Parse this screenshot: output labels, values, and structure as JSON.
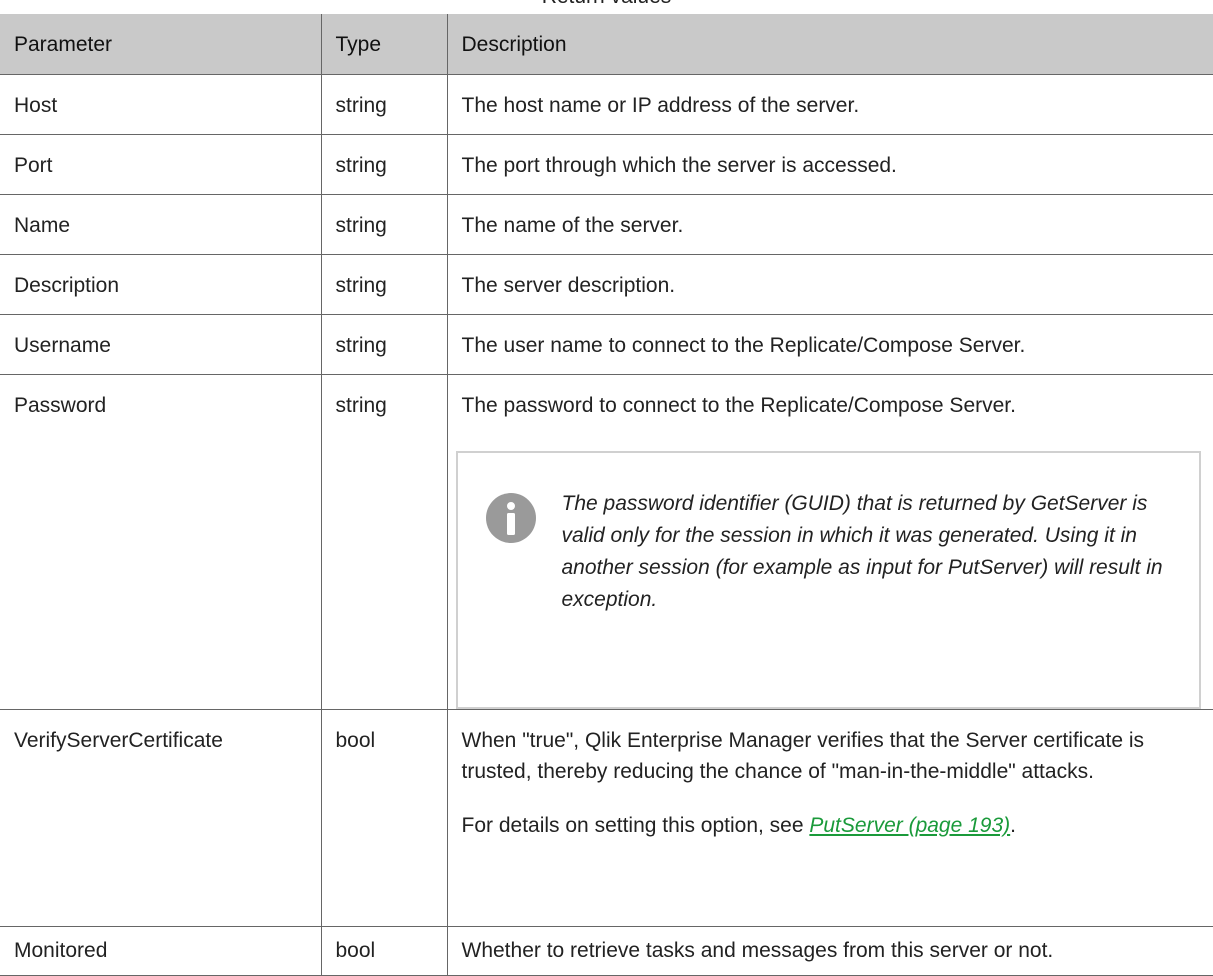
{
  "caption": "Return values",
  "table": {
    "headers": [
      "Parameter",
      "Type",
      "Description"
    ],
    "rows": [
      {
        "parameter": "Host",
        "type": "string",
        "description": "The host name or IP address of the server."
      },
      {
        "parameter": "Port",
        "type": "string",
        "description": "The port through which the server is accessed."
      },
      {
        "parameter": "Name",
        "type": "string",
        "description": "The name of the server."
      },
      {
        "parameter": "Description",
        "type": "string",
        "description": "The server description."
      },
      {
        "parameter": "Username",
        "type": "string",
        "description": "The user name to connect to the Replicate/Compose Server."
      },
      {
        "parameter": "Password",
        "type": "string",
        "description": "The password to connect to the Replicate/Compose Server.",
        "note": {
          "icon": "info-icon",
          "text": "The password identifier (GUID) that is returned by GetServer is valid only for the session in which it was generated. Using it in another session (for example as input for PutServer) will result in exception."
        }
      },
      {
        "parameter": "VerifyServerCertificate",
        "type": "bool",
        "description": "When \"true\", Qlik Enterprise Manager verifies that the Server certificate is trusted, thereby reducing the chance of \"man-in-the-middle\" attacks.",
        "details_prefix": "For details on setting this option, see ",
        "details_link": "PutServer (page 193)",
        "details_suffix": "."
      },
      {
        "parameter": "Monitored",
        "type": "bool",
        "description": "Whether to retrieve tasks and messages from this server or not."
      }
    ]
  },
  "colors": {
    "header_bg": "#c9c9c9",
    "link": "#1a9a3a",
    "note_icon": "#9a9a9a"
  }
}
